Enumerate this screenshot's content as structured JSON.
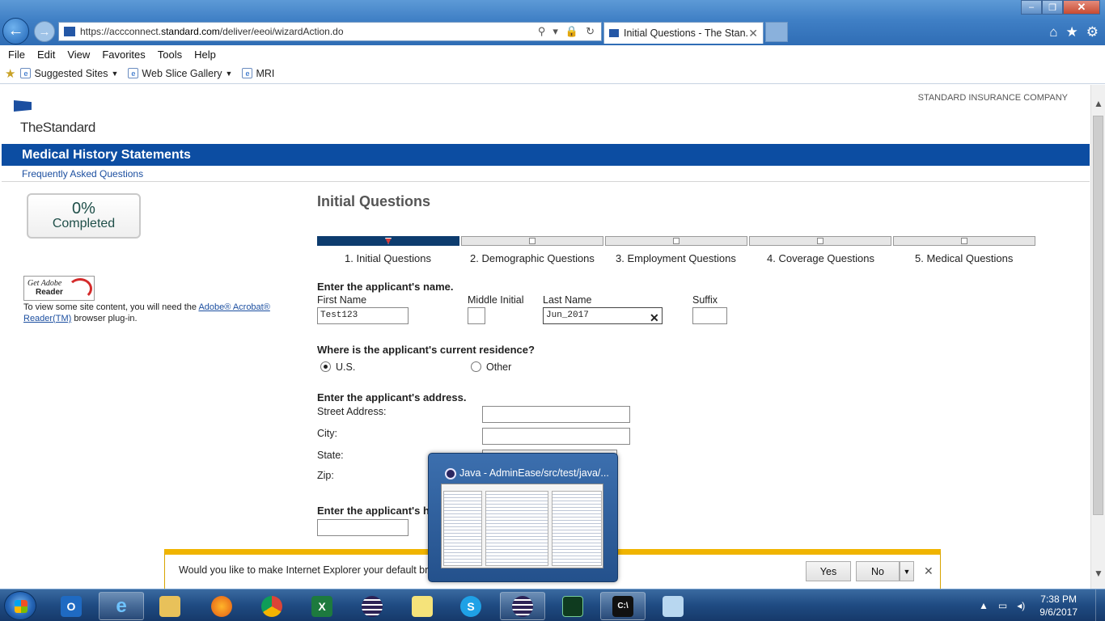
{
  "browser": {
    "url_prefix": "https://accconnect.",
    "url_domain": "standard.com",
    "url_path": "/deliver/eeoi/wizardAction.do",
    "tab_title": "Initial Questions - The Stan...",
    "address_tools": [
      "⚲",
      "▾",
      "🔒",
      "↻"
    ],
    "menu": [
      "File",
      "Edit",
      "View",
      "Favorites",
      "Tools",
      "Help"
    ],
    "favorites": [
      "Suggested Sites",
      "Web Slice Gallery",
      "MRI"
    ],
    "window_controls": {
      "minimize": "–",
      "restore": "❐",
      "close": "✕"
    },
    "chrome_icons": {
      "home": "⌂",
      "favorites": "★",
      "tools": "⚙"
    }
  },
  "page": {
    "company": "STANDARD INSURANCE COMPANY",
    "logo_text": "TheStandard",
    "banner_title": "Medical History Statements",
    "faq_link": "Frequently Asked Questions",
    "progress": {
      "percent": "0%",
      "label": "Completed"
    },
    "adobe": {
      "badge_line1": "Get Adobe",
      "badge_line2": "Reader",
      "text_before": "To view some site content, you will need the ",
      "link_text": "Adobe® Acrobat® Reader(TM)",
      "text_after": " browser plug-in."
    },
    "section_title": "Initial Questions",
    "steps": [
      {
        "label": "1. Initial Questions",
        "active": true
      },
      {
        "label": "2. Demographic Questions",
        "active": false
      },
      {
        "label": "3. Employment Questions",
        "active": false
      },
      {
        "label": "4. Coverage Questions",
        "active": false
      },
      {
        "label": "5. Medical Questions",
        "active": false
      }
    ],
    "name_section": {
      "heading": "Enter the applicant's name.",
      "first_name_label": "First Name",
      "first_name_value": "Test123",
      "middle_initial_label": "Middle Initial",
      "middle_initial_value": "",
      "last_name_label": "Last Name",
      "last_name_value": "Jun_2017",
      "suffix_label": "Suffix",
      "suffix_value": ""
    },
    "residence": {
      "heading": "Where is the applicant's current residence?",
      "options": [
        "U.S.",
        "Other"
      ],
      "selected": "U.S."
    },
    "address": {
      "heading": "Enter the applicant's address.",
      "street_label": "Street Address:",
      "city_label": "City:",
      "state_label": "State:",
      "zip_label": "Zip:"
    },
    "partial_heading": "Enter the applicant's h"
  },
  "notification": {
    "text": "Would you like to make Internet Explorer your default brow",
    "yes": "Yes",
    "no": "No",
    "dropdown": "▼",
    "close": "✕"
  },
  "thumbnail": {
    "title": "Java - AdminEase/src/test/java/..."
  },
  "taskbar": {
    "apps": [
      "outlook",
      "internet-explorer",
      "file-explorer",
      "firefox",
      "chrome",
      "excel",
      "eclipse",
      "sticky-notes",
      "skype",
      "eclipse",
      "task-manager",
      "command-prompt",
      "notepad"
    ],
    "time": "7:38 PM",
    "date": "9/6/2017"
  }
}
